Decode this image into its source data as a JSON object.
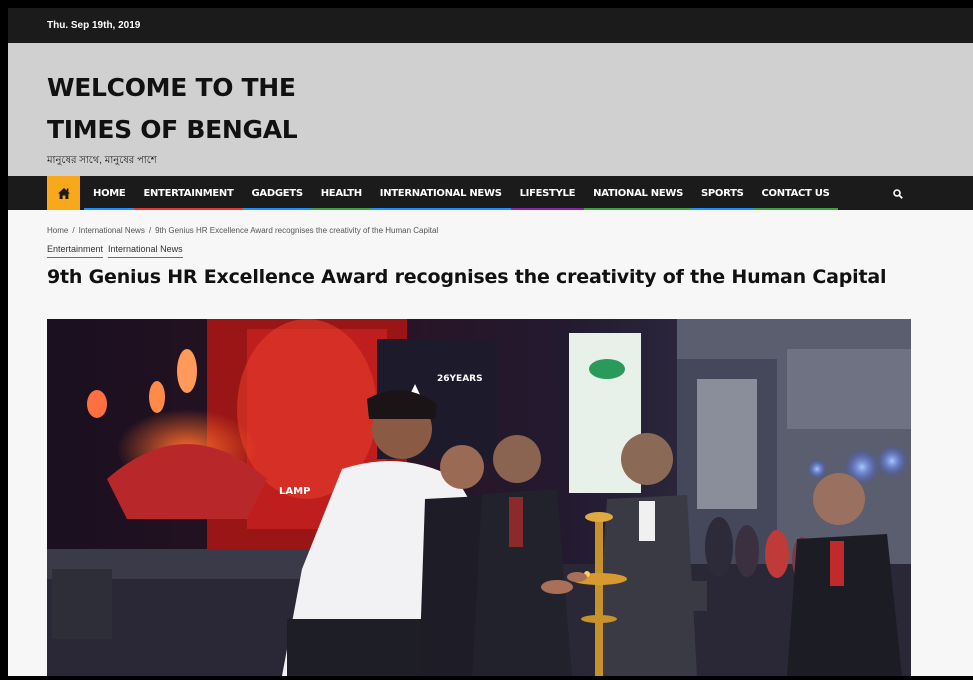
{
  "topbar": {
    "date": "Thu. Sep 19th, 2019"
  },
  "masthead": {
    "title_line1": "WELCOME TO THE",
    "title_line2": "TIMES OF BENGAL",
    "tagline": "মানুষের সাথে, মানুষের পাশে"
  },
  "nav": {
    "home_icon": "home-icon",
    "search_icon": "search-icon",
    "items": [
      {
        "label": "HOME",
        "color": "#1e90ff"
      },
      {
        "label": "ENTERTAINMENT",
        "color": "#e53935"
      },
      {
        "label": "GADGETS",
        "color": "#1e90ff"
      },
      {
        "label": "HEALTH",
        "color": "#43a047"
      },
      {
        "label": "INTERNATIONAL NEWS",
        "color": "#1e90ff"
      },
      {
        "label": "LIFESTYLE",
        "color": "#8e24aa"
      },
      {
        "label": "NATIONAL NEWS",
        "color": "#43a047"
      },
      {
        "label": "SPORTS",
        "color": "#1e90ff"
      },
      {
        "label": "CONTACT US",
        "color": "#43a047"
      }
    ]
  },
  "breadcrumb": {
    "items": [
      "Home",
      "International News",
      "9th Genius HR Excellence Award recognises the creativity of the Human Capital"
    ],
    "separator": "/"
  },
  "categories": [
    "Entertainment",
    "International News"
  ],
  "article": {
    "headline": "9th Genius HR Excellence Award recognises the creativity of the Human Capital",
    "stage_logo": "26YEARS",
    "stage_text": "LAMP"
  },
  "colors": {
    "accent": "#f7a81b",
    "dark": "#1b1b1b",
    "masthead_bg": "#d0d0d0"
  }
}
